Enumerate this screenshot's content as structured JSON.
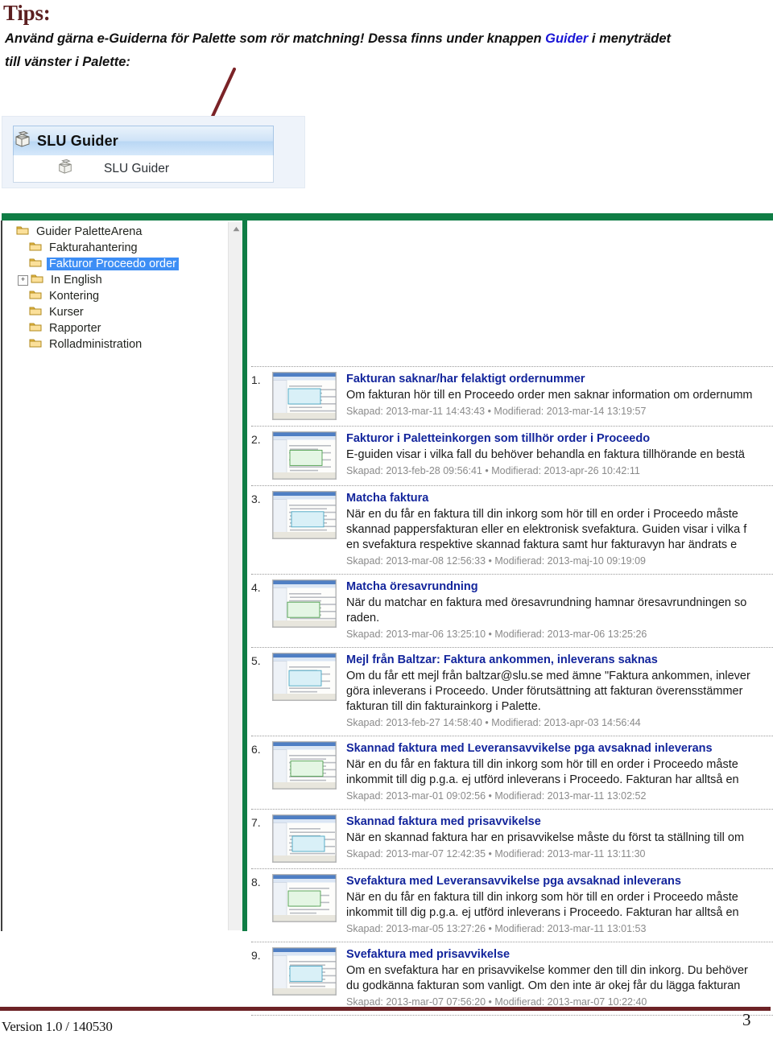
{
  "header": {
    "title": "Tips:",
    "paragraph_prefix": " Använd gärna e-Guiderna för Palette som rör matchning! Dessa finns under knappen ",
    "paragraph_highlight": "Guider",
    "paragraph_suffix": " i menyträdet",
    "paragraph_line2": "till vänster i Palette:",
    "title_color": "#5c1f20",
    "highlight_color": "#1a16d6"
  },
  "guider_button": {
    "header_label": "SLU Guider",
    "item_label": "SLU Guider",
    "header_icon": "package-box-icon",
    "item_icon": "package-box-icon"
  },
  "annotation": {
    "arrow_icon": "arrow-pointer-icon",
    "arrow_color": "#7b2327"
  },
  "tree": {
    "scrollbar_up_icon": "scroll-up-arrow-icon",
    "items": [
      {
        "label": "Guider PaletteArena",
        "indent": 0,
        "twisty": "",
        "selected": false,
        "icon": "folder-icon"
      },
      {
        "label": "Fakturahantering",
        "indent": 1,
        "twisty": "",
        "selected": false,
        "icon": "folder-icon"
      },
      {
        "label": "Fakturor Proceedo order",
        "indent": 1,
        "twisty": "",
        "selected": true,
        "icon": "folder-icon"
      },
      {
        "label": "In English",
        "indent": 1,
        "twisty": "+",
        "selected": false,
        "icon": "folder-icon"
      },
      {
        "label": "Kontering",
        "indent": 1,
        "twisty": "",
        "selected": false,
        "icon": "folder-icon"
      },
      {
        "label": "Kurser",
        "indent": 1,
        "twisty": "",
        "selected": false,
        "icon": "folder-icon"
      },
      {
        "label": "Rapporter",
        "indent": 1,
        "twisty": "",
        "selected": false,
        "icon": "folder-icon"
      },
      {
        "label": "Rolladministration",
        "indent": 1,
        "twisty": "",
        "selected": false,
        "icon": "folder-icon"
      }
    ]
  },
  "guide_list": [
    {
      "num": "1.",
      "title": "Fakturan saknar/har felaktigt ordernummer",
      "desc": [
        "Om fakturan hör till en Proceedo order men saknar information om ordernumm"
      ],
      "meta": "Skapad: 2013-mar-11 14:43:43 • Modifierad: 2013-mar-14 13:19:57"
    },
    {
      "num": "2.",
      "title": "Fakturor i Paletteinkorgen som tillhör order i Proceedo",
      "desc": [
        "E-guiden visar i vilka fall du behöver behandla en faktura tillhörande en bestä"
      ],
      "meta": "Skapad: 2013-feb-28 09:56:41 • Modifierad: 2013-apr-26 10:42:11"
    },
    {
      "num": "3.",
      "title": "Matcha faktura",
      "desc": [
        "När en du får en faktura till din inkorg som hör till en order i Proceedo måste",
        "skannad pappersfakturan eller en elektronisk svefaktura. Guiden visar i vilka f",
        "en svefaktura respektive skannad faktura samt hur fakturavyn har ändrats e"
      ],
      "meta": "Skapad: 2013-mar-08 12:56:33 • Modifierad: 2013-maj-10 09:19:09"
    },
    {
      "num": "4.",
      "title": "Matcha öresavrundning",
      "desc": [
        "När du matchar en faktura med öresavrundning hamnar öresavrundningen so",
        "raden."
      ],
      "meta": "Skapad: 2013-mar-06 13:25:10 • Modifierad: 2013-mar-06 13:25:26"
    },
    {
      "num": "5.",
      "title": "Mejl från Baltzar: Faktura ankommen, inleverans saknas",
      "desc": [
        "Om du får ett mejl från baltzar@slu.se med ämne \"Faktura ankommen, inlever",
        "göra inleverans i Proceedo. Under förutsättning att fakturan överensstämmer",
        "fakturan till din fakturainkorg i Palette."
      ],
      "meta": "Skapad: 2013-feb-27 14:58:40 • Modifierad: 2013-apr-03 14:56:44"
    },
    {
      "num": "6.",
      "title": "Skannad faktura med Leveransavvikelse pga avsaknad inleverans",
      "desc": [
        "När en du får en faktura till din inkorg som hör till en order i Proceedo måste",
        "inkommit till dig p.g.a. ej utförd inleverans i Proceedo. Fakturan har alltså en"
      ],
      "meta": "Skapad: 2013-mar-01 09:02:56 • Modifierad: 2013-mar-11 13:02:52"
    },
    {
      "num": "7.",
      "title": "Skannad faktura med prisavvikelse",
      "desc": [
        "När en skannad faktura har en prisavvikelse måste du först ta ställning till om"
      ],
      "meta": "Skapad: 2013-mar-07 12:42:35 • Modifierad: 2013-mar-11 13:11:30"
    },
    {
      "num": "8.",
      "title": "Svefaktura med Leveransavvikelse pga avsaknad inleverans",
      "desc": [
        "När en du får en faktura till din inkorg som hör till en order i Proceedo måste",
        "inkommit till dig p.g.a. ej utförd inleverans i Proceedo. Fakturan har alltså en"
      ],
      "meta": "Skapad: 2013-mar-05 13:27:26 • Modifierad: 2013-mar-11 13:01:53"
    },
    {
      "num": "9.",
      "title": "Svefaktura med prisavvikelse",
      "desc": [
        "Om en svefaktura har en prisavvikelse kommer den till din inkorg. Du behöver",
        "du godkänna fakturan som vanligt. Om den inte är okej får du lägga fakturan"
      ],
      "meta": "Skapad: 2013-mar-07 07:56:20 • Modifierad: 2013-mar-07 10:22:40"
    }
  ],
  "footer": {
    "version": "Version 1.0  / 140530",
    "page_number": "3",
    "rule_color": "#6d2326"
  }
}
